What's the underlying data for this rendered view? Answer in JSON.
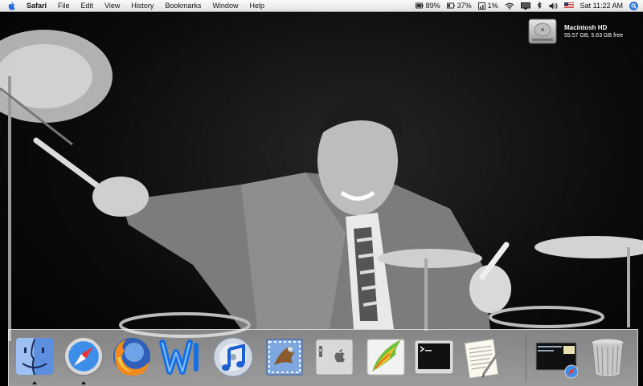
{
  "menubar": {
    "app_name": "Safari",
    "menus": [
      "File",
      "Edit",
      "View",
      "History",
      "Bookmarks",
      "Window",
      "Help"
    ],
    "status": {
      "battery_a": "89%",
      "battery_b": "37%",
      "cpu": "1%",
      "clock": "Sat 11:22 AM"
    }
  },
  "desktop": {
    "disk": {
      "name": "Macintosh HD",
      "info": "55.57 GB, 5.63 GB free"
    }
  },
  "dock": {
    "items": [
      {
        "icon": "finder-icon",
        "running": true
      },
      {
        "icon": "safari-icon",
        "running": true
      },
      {
        "icon": "firefox-icon",
        "running": false
      },
      {
        "icon": "wiki-w-icon",
        "running": false
      },
      {
        "icon": "itunes-icon",
        "running": false
      },
      {
        "icon": "mail-icon",
        "running": false
      },
      {
        "icon": "system-preferences-icon",
        "running": false
      },
      {
        "icon": "feather-app-icon",
        "running": false
      },
      {
        "icon": "terminal-icon",
        "running": false
      },
      {
        "icon": "textedit-icon",
        "running": false
      },
      {
        "icon": "minimized-window-icon",
        "running": false
      },
      {
        "icon": "trash-icon",
        "running": false
      }
    ]
  },
  "colors": {
    "menubar_bg": "#eeeeee",
    "spotlight_blue": "#3b78d8",
    "dock_bg": "#d8d8d8"
  }
}
